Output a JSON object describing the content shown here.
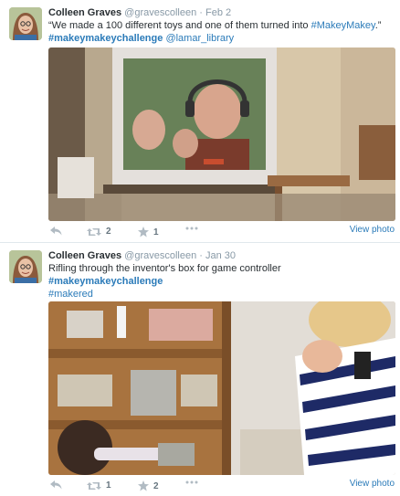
{
  "tweets": [
    {
      "name": "Colleen Graves",
      "handle": "@gravescolleen",
      "separator": "·",
      "time": "Feb 2",
      "text_plain": "“We made a 100 different toys and one of them turned into ",
      "text_link1": "#MakeyMakey",
      "text_after": ".”",
      "text_link2": "#makeymakeychallenge",
      "text_link3": "@lamar_library",
      "retweets": "2",
      "favorites": "1",
      "view_photo": "View photo",
      "icons": [
        "reply-icon",
        "retweet-icon",
        "favorite-icon",
        "more-icon"
      ]
    },
    {
      "name": "Colleen Graves",
      "handle": "@gravescolleen",
      "separator": "·",
      "time": "Jan 30",
      "text_plain": "Rifling through the inventor's box for game controller ",
      "text_link1": "#makeymakeychallenge",
      "text_link2": "#makered",
      "retweets": "1",
      "favorites": "2",
      "view_photo": "View photo",
      "icons": [
        "reply-icon",
        "retweet-icon",
        "favorite-icon",
        "more-icon"
      ]
    }
  ],
  "colors": {
    "link": "#2b7bb9",
    "muted": "#8899a6",
    "text": "#292f33"
  }
}
